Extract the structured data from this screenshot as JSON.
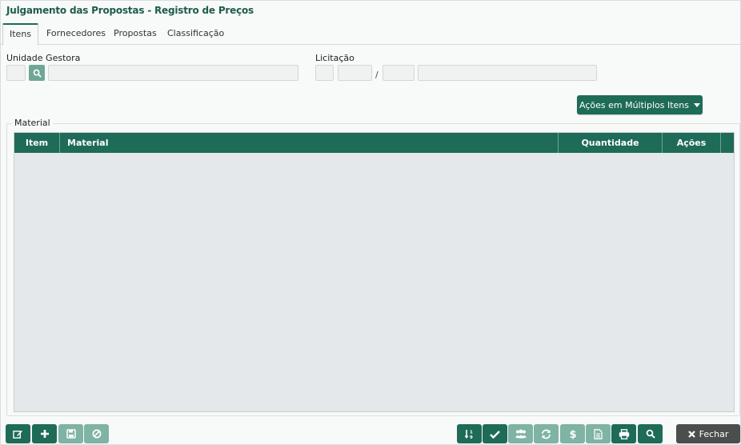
{
  "window": {
    "title": "Julgamento das Propostas - Registro de Preços"
  },
  "tabs": [
    {
      "label": "Itens",
      "active": true
    },
    {
      "label": "Fornecedores",
      "active": false
    },
    {
      "label": "Propostas",
      "active": false
    },
    {
      "label": "Classificação",
      "active": false
    }
  ],
  "filters": {
    "unidade_gestora_label": "Unidade Gestora",
    "licitacao_label": "Licitação",
    "licitacao_separator": "/"
  },
  "actions": {
    "multi_items_label": "Ações em Múltiplos Itens"
  },
  "material_section": {
    "legend": "Material",
    "columns": [
      "Item",
      "Material",
      "Quantidade",
      "Ações"
    ],
    "rows": []
  },
  "bottom_toolbar": {
    "left_buttons": [
      {
        "icon": "edit-icon",
        "enabled": true
      },
      {
        "icon": "plus-icon",
        "enabled": true
      },
      {
        "icon": "save-icon",
        "enabled": false
      },
      {
        "icon": "cancel-icon",
        "enabled": false
      }
    ],
    "right_buttons": [
      {
        "icon": "sort-numeric-icon",
        "enabled": true
      },
      {
        "icon": "check-icon",
        "enabled": true
      },
      {
        "icon": "users-icon",
        "enabled": false
      },
      {
        "icon": "refresh-icon",
        "enabled": false
      },
      {
        "icon": "dollar-icon",
        "enabled": false
      },
      {
        "icon": "document-icon",
        "enabled": false
      },
      {
        "icon": "print-icon",
        "enabled": true
      },
      {
        "icon": "search-icon",
        "enabled": true
      }
    ],
    "close_label": "Fechar"
  },
  "colors": {
    "primary": "#1e6b57",
    "primary_disabled": "#7fb3a4",
    "title": "#1e5c4c",
    "close_button": "#4a4f4e",
    "grid_background": "#e4e8ea"
  }
}
